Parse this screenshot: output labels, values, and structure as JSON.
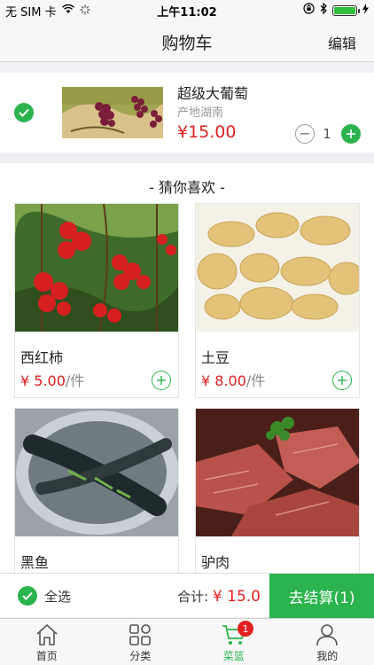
{
  "status_bar": {
    "carrier": "无 SIM 卡",
    "time": "上午11:02"
  },
  "nav": {
    "title": "购物车",
    "edit_label": "编辑"
  },
  "cart_item": {
    "name": "超级大葡萄",
    "origin": "产地湖南",
    "price": "¥15.00",
    "quantity": "1",
    "checked": true
  },
  "recommendations": {
    "title": "- 猜你喜欢 -",
    "products": [
      {
        "name": "西红柿",
        "price": "¥ 5.00",
        "unit": "/件"
      },
      {
        "name": "土豆",
        "price": "¥ 8.00",
        "unit": "/件"
      },
      {
        "name": "黑鱼"
      },
      {
        "name": "驴肉"
      }
    ]
  },
  "checkout": {
    "select_all_label": "全选",
    "total_label": "合计:",
    "total_amount": "¥ 15.0",
    "button_label": "去结算(1)"
  },
  "tab_bar": {
    "tabs": [
      {
        "label": "首页",
        "icon": "home-icon"
      },
      {
        "label": "分类",
        "icon": "category-icon"
      },
      {
        "label": "菜篮",
        "icon": "cart-icon",
        "badge": "1",
        "active": true
      },
      {
        "label": "我的",
        "icon": "user-icon"
      }
    ]
  },
  "colors": {
    "accent": "#2bb44e",
    "price": "#e02020",
    "background": "#efeff4"
  }
}
